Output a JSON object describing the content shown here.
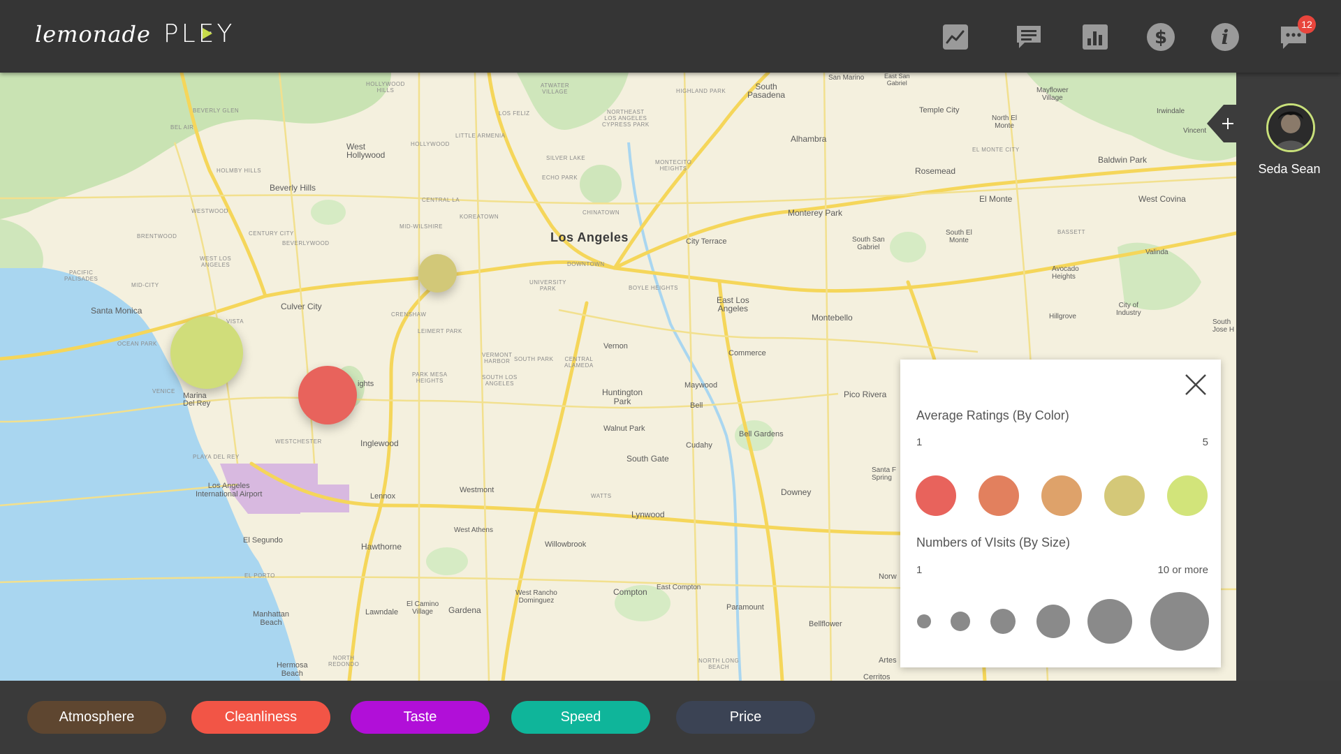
{
  "app": {
    "logo_script": "lemonade",
    "logo_product": "PLEY"
  },
  "topbar": {
    "icons": [
      "trend-chart-icon",
      "chat-icon",
      "bar-chart-icon",
      "dollar-icon",
      "info-icon",
      "messages-icon"
    ],
    "notification_count": "12"
  },
  "user": {
    "name": "Seda Sean"
  },
  "map": {
    "labels": {
      "los_angeles": "Los Angeles",
      "santa_monica": "Santa Monica",
      "culver_city": "Culver City",
      "beverly_hills": "Beverly Hills",
      "west_hollywood": "West\nHollywood",
      "inglewood": "Inglewood",
      "lennox": "Lennox",
      "hawthorne": "Hawthorne",
      "el_segundo": "El Segundo",
      "lax": "Los Angeles\nInternational Airport",
      "marina": "Marina\nDel Rey",
      "manhattan_beach": "Manhattan\nBeach",
      "hermosa_beach": "Hermosa\nBeach",
      "lawndale": "Lawndale",
      "gardena": "Gardena",
      "compton": "Compton",
      "westmont": "Westmont",
      "south_gate": "South Gate",
      "lynwood": "Lynwood",
      "downey": "Downey",
      "huntington_park": "Huntington\nPark",
      "walnut_park": "Walnut Park",
      "cudahy": "Cudahy",
      "bell": "Bell",
      "maywood": "Maywood",
      "bell_gardens": "Bell Gardens",
      "commerce": "Commerce",
      "vernon": "Vernon",
      "east_los_angeles": "East Los\nAngeles",
      "montebello": "Montebello",
      "pico_rivera": "Pico Rivera",
      "monterey_park": "Monterey Park",
      "alhambra": "Alhambra",
      "rosemead": "Rosemead",
      "el_monte": "El Monte",
      "west_covina": "West Covina",
      "baldwin_park": "Baldwin Park",
      "temple_city": "Temple City",
      "south_pasadena": "South\nPasadena",
      "city_terrace": "City Terrace",
      "paramount": "Paramount",
      "bellflower": "Bellflower",
      "willowbrook": "Willowbrook",
      "west_athens": "West Athens",
      "avocado_heights": "Avocado\nHeights",
      "south_el_monte": "South El\nMonte",
      "valinda": "Valinda",
      "south_san_gabriel": "South San\nGabriel",
      "east_compton": "East Compton",
      "west_rancho": "West Rancho\nDominguez",
      "el_camino": "El Camino\nVillage",
      "mayflower": "Mayflower\nVillage",
      "north_el_monte": "North El\nMonte",
      "irwindale": "Irwindale",
      "vincent": "Vincent",
      "hillgrove": "Hillgrove",
      "city_of_industry": "City of\nIndustry",
      "santa_fe_springs": "Santa F\nSpring",
      "norw": "Norw",
      "artes": "Artes",
      "cerritos": "Cerritos",
      "san_marino": "San Marino",
      "east_san_gabriel": "East San\nGabriel",
      "south_jose": "South\nJose H",
      "downtown": "DOWNTOWN",
      "koreatown": "KOREATOWN",
      "chinatown": "CHINATOWN",
      "highland_park": "HIGHLAND PARK",
      "silver_lake": "SILVER LAKE",
      "echo_park": "ECHO PARK",
      "mid_wilshire": "MID-WILSHIRE",
      "central_la": "CENTRAL LA",
      "hollywood": "HOLLYWOOD",
      "little_armenia": "LITTLE ARMENIA",
      "los_feliz": "LOS FELIZ",
      "atwater": "ATWATER\nVILLAGE",
      "boyle_heights": "BOYLE HEIGHTS",
      "university_park": "UNIVERSITY\nPARK",
      "leimert_park": "LEIMERT PARK",
      "crenshaw": "CRENSHAW",
      "westchester": "WESTCHESTER",
      "playa_del_rey": "PLAYA DEL REY",
      "ocean_park": "OCEAN PARK",
      "venice": "VENICE",
      "mid_city": "MID-CITY",
      "pacific_palisades": "PACIFIC\nPALISADES",
      "brentwood": "BRENTWOOD",
      "westwood": "WESTWOOD",
      "century_city": "CENTURY CITY",
      "beverlywood": "BEVERLYWOOD",
      "west_la": "WEST LOS\nANGELES",
      "bel_air": "BEL AIR",
      "beverly_glen": "BEVERLY GLEN",
      "holmby_hills": "HOLMBY HILLS",
      "hollywood_hills": "HOLLYWOOD\nHILLS",
      "vermont_harbor": "VERMONT\nHARBOR",
      "south_park": "SOUTH PARK",
      "central_alameda": "CENTRAL\nALAMEDA",
      "park_mesa": "PARK MESA\nHEIGHTS",
      "south_los_angeles": "SOUTH LOS\nANGELES",
      "watts": "WATTS",
      "el_porto": "EL PORTO",
      "north_redondo": "NORTH\nREDONDO",
      "north_long_beach": "NORTH LONG\nBEACH",
      "el_monte_city": "EL MONTE CITY",
      "bassett": "BASSETT",
      "montecito_heights": "MONTECITO\nHEIGHTS",
      "northeast_la": "NORTHEAST\nLOS ANGELES\nCYPRESS PARK",
      "ights": "ights",
      "vista": "VISTA"
    },
    "markers": [
      {
        "name": "marker-1",
        "color": "#d2c878",
        "rating": 4,
        "visits": 3
      },
      {
        "name": "marker-2",
        "color": "#d0dd7a",
        "rating": 5,
        "visits": 10
      },
      {
        "name": "marker-3",
        "color": "#e8635c",
        "rating": 1,
        "visits": 5
      }
    ]
  },
  "legend": {
    "color_title": "Average Ratings (By Color)",
    "color_min": "1",
    "color_max": "5",
    "rating_colors": [
      "#e8635c",
      "#e2805e",
      "#dea26a",
      "#d4c878",
      "#d2e47a"
    ],
    "size_title": "Numbers of VIsits (By Size)",
    "size_min": "1",
    "size_max": "10 or more",
    "size_color": "#8a8a8a"
  },
  "filters": [
    {
      "label": "Atmosphere",
      "color": "#5e4630"
    },
    {
      "label": "Cleanliness",
      "color": "#f25546"
    },
    {
      "label": "Taste",
      "color": "#b10fd8"
    },
    {
      "label": "Speed",
      "color": "#0fb59a"
    },
    {
      "label": "Price",
      "color": "#3b4354"
    }
  ]
}
